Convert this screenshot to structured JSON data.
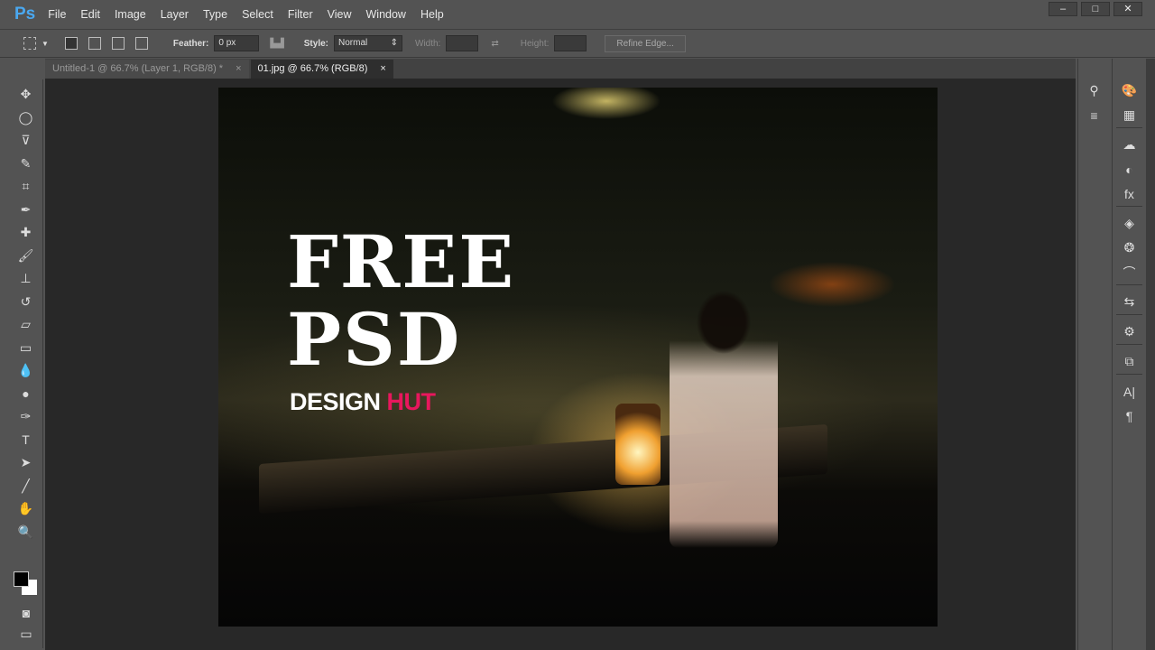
{
  "app": {
    "logo": "Ps",
    "menu": [
      "File",
      "Edit",
      "Image",
      "Layer",
      "Type",
      "Select",
      "Filter",
      "View",
      "Window",
      "Help"
    ],
    "window_buttons": [
      "–",
      "□",
      "✕"
    ]
  },
  "options": {
    "feather_label": "Feather:",
    "feather_value": "0 px",
    "style_label": "Style:",
    "style_value": "Normal",
    "width_label": "Width:",
    "height_label": "Height:",
    "refine_edge": "Refine Edge..."
  },
  "tabs": [
    {
      "label": "Untitled-1 @ 66.7% (Layer 1, RGB/8) *",
      "close": "×"
    },
    {
      "label": "01.jpg @ 66.7% (RGB/8)",
      "close": "×",
      "active": true
    }
  ],
  "tools": [
    {
      "name": "move",
      "g": "✥"
    },
    {
      "name": "ellipse-marquee",
      "g": "◯"
    },
    {
      "name": "polygonal-lasso",
      "g": "⊽"
    },
    {
      "name": "quick-selection",
      "g": "✎"
    },
    {
      "name": "crop",
      "g": "⌗"
    },
    {
      "name": "eyedropper",
      "g": "✒"
    },
    {
      "name": "healing-brush",
      "g": "✚"
    },
    {
      "name": "brush",
      "g": "🖌"
    },
    {
      "name": "clone-stamp",
      "g": "⊥"
    },
    {
      "name": "history-brush",
      "g": "↺"
    },
    {
      "name": "eraser",
      "g": "▱"
    },
    {
      "name": "gradient",
      "g": "▭"
    },
    {
      "name": "blur",
      "g": "💧"
    },
    {
      "name": "dodge",
      "g": "●"
    },
    {
      "name": "pen",
      "g": "✑"
    },
    {
      "name": "type",
      "g": "T"
    },
    {
      "name": "path-selection",
      "g": "➤"
    },
    {
      "name": "line",
      "g": "╱"
    },
    {
      "name": "hand",
      "g": "✋"
    },
    {
      "name": "zoom",
      "g": "🔍"
    }
  ],
  "colors": {
    "foreground": "#000000",
    "background": "#ffffff",
    "accent": "#e8175d"
  },
  "canvas": {
    "headline1": "FREE",
    "headline2": "PSD",
    "tagline_a": "DESIGN ",
    "tagline_b": "HUT"
  },
  "panel1": [
    {
      "name": "brush-presets",
      "g": "⚲"
    },
    {
      "name": "adjust",
      "g": "≡"
    }
  ],
  "panel2": [
    {
      "name": "color",
      "g": "🎨"
    },
    {
      "name": "swatches",
      "g": "▦"
    },
    {
      "name": "libraries",
      "g": "☁"
    },
    {
      "name": "adjustments",
      "g": "◐"
    },
    {
      "name": "styles",
      "g": "fx"
    },
    {
      "name": "layers",
      "g": "◈"
    },
    {
      "name": "channels",
      "g": "❂"
    },
    {
      "name": "paths",
      "g": "⌒"
    },
    {
      "name": "history",
      "g": "⇆"
    },
    {
      "name": "properties",
      "g": "⚙"
    },
    {
      "name": "clone-source",
      "g": "⧉"
    },
    {
      "name": "character",
      "g": "A|"
    },
    {
      "name": "paragraph",
      "g": "¶"
    }
  ]
}
